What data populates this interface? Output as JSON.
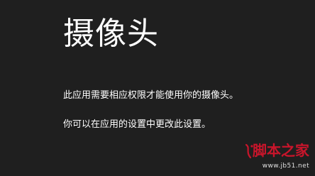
{
  "screen": {
    "title": "摄像头",
    "permission_message": "此应用需要相应权限才能使用你的摄像头。",
    "settings_hint": "你可以在应用的设置中更改此设置。"
  },
  "watermark": {
    "site_name": "脚本之家",
    "site_url": "www.jb51.net"
  },
  "colors": {
    "background": "#1f1f1f",
    "text": "#ffffff",
    "watermark_red": "#c9152b"
  }
}
